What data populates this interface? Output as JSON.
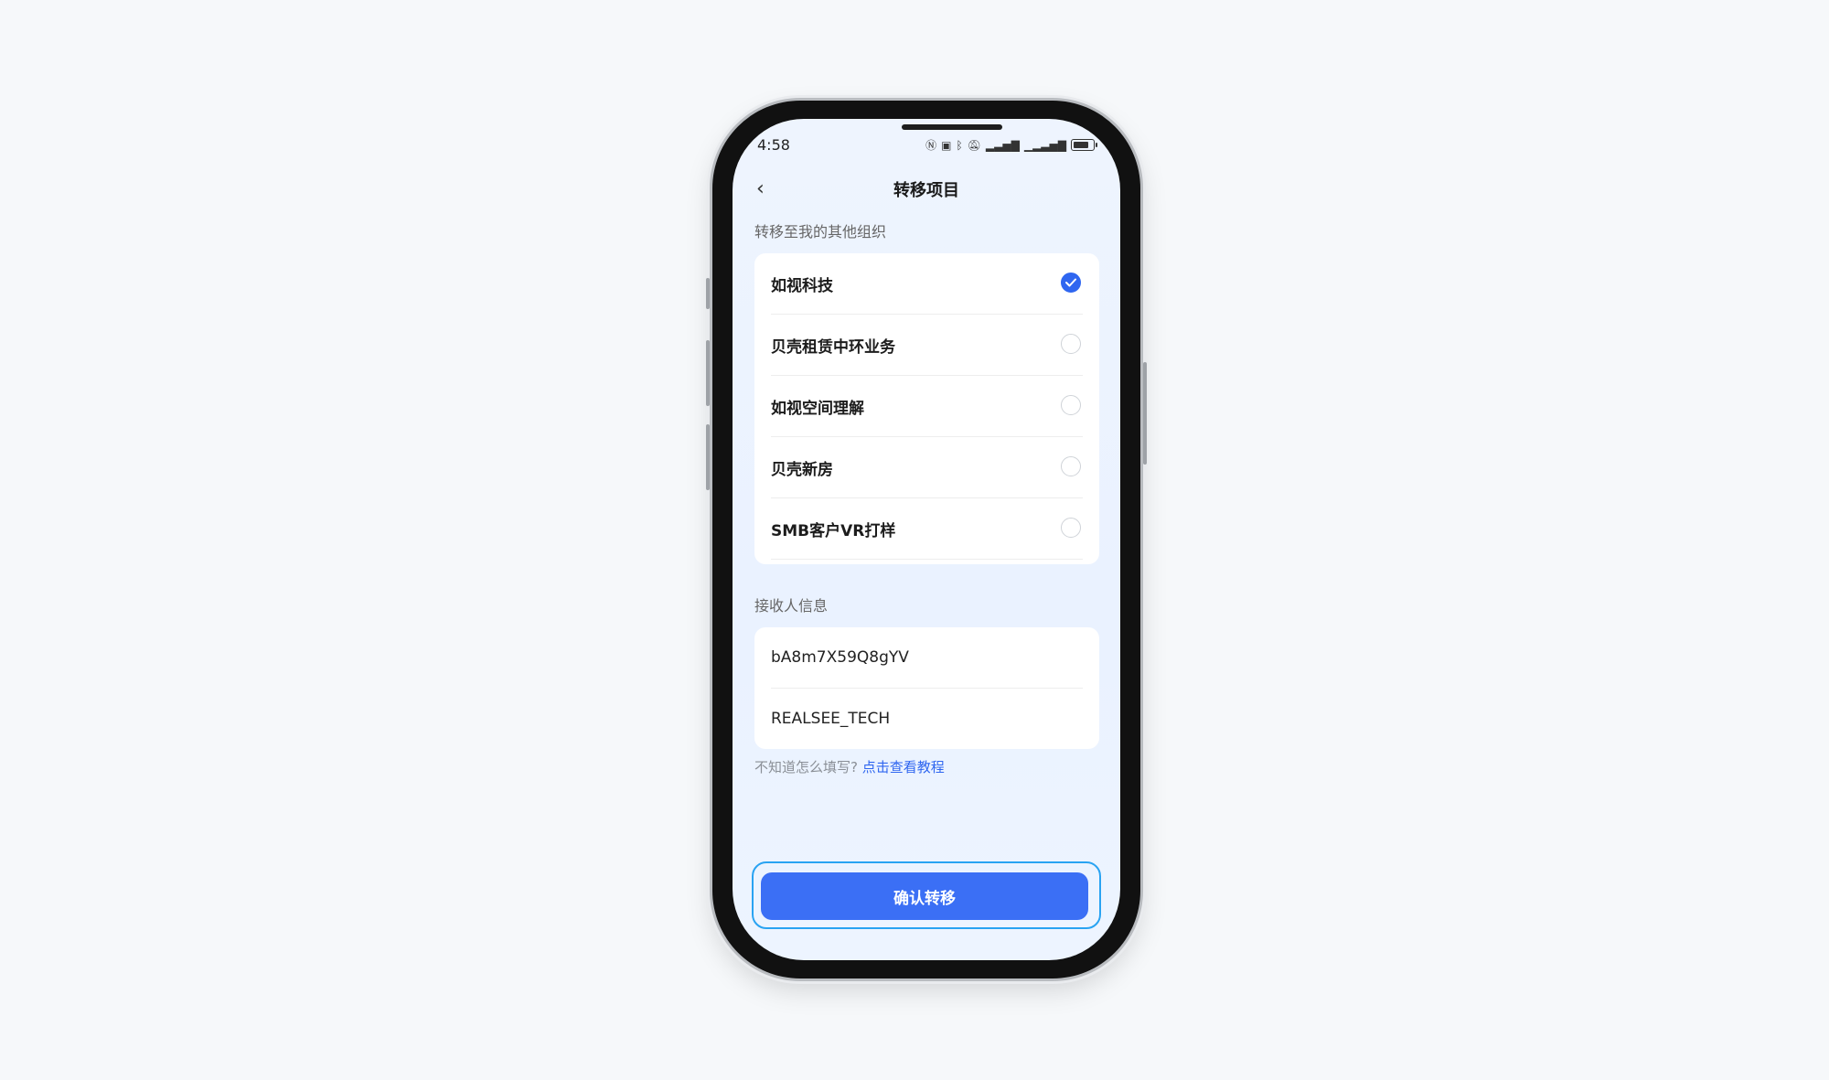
{
  "status": {
    "time": "4:58"
  },
  "header": {
    "title": "转移项目"
  },
  "orgs": {
    "label": "转移至我的其他组织",
    "items": [
      {
        "name": "如视科技",
        "checked": true
      },
      {
        "name": "贝壳租赁中环业务",
        "checked": false
      },
      {
        "name": "如视空间理解",
        "checked": false
      },
      {
        "name": "贝壳新房",
        "checked": false
      },
      {
        "name": "SMB客户VR打样",
        "checked": false
      }
    ]
  },
  "receiver": {
    "label": "接收人信息",
    "id": "bA8m7X59Q8gYV",
    "name": "REALSEE_TECH"
  },
  "hint": {
    "text": "不知道怎么填写?",
    "link": "点击查看教程"
  },
  "actions": {
    "confirm": "确认转移"
  },
  "colors": {
    "accent": "#3b6ff5",
    "focus_ring": "#29a3f2"
  }
}
